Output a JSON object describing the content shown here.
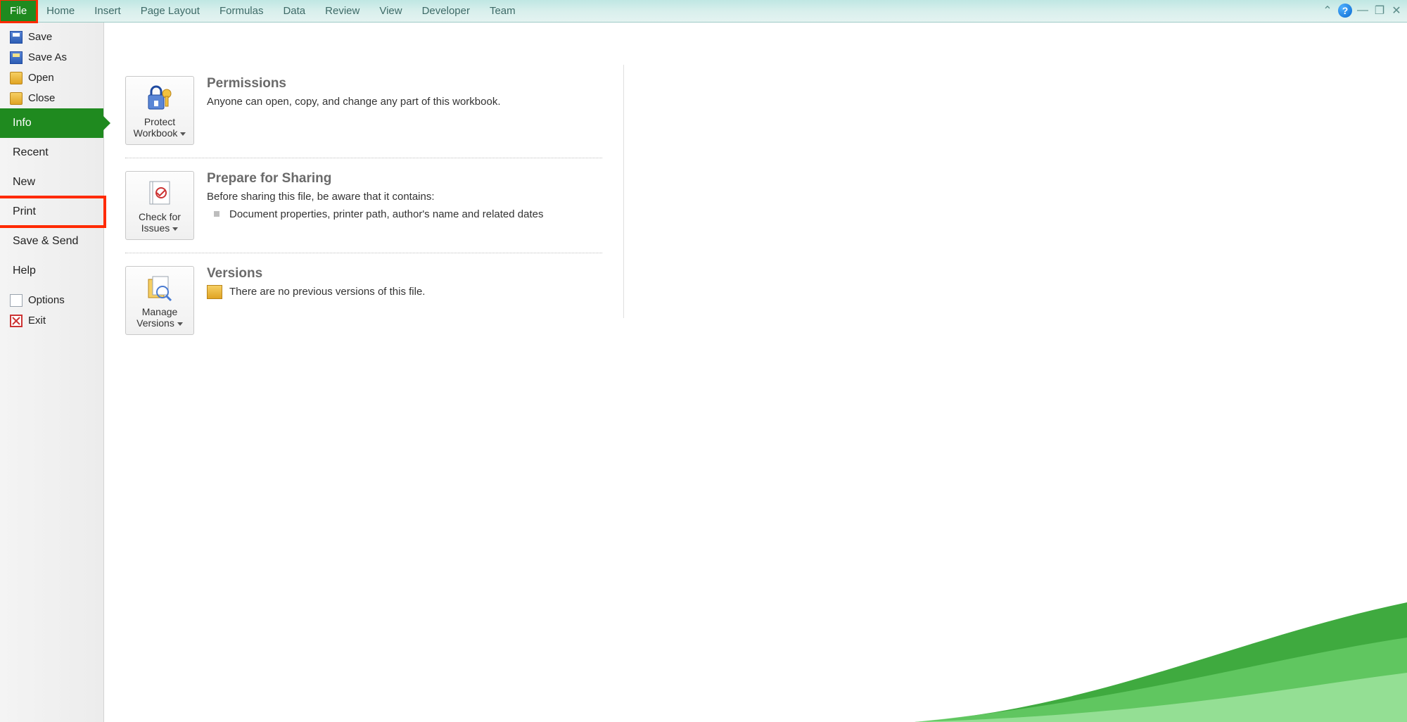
{
  "ribbon": {
    "tabs": [
      "File",
      "Home",
      "Insert",
      "Page Layout",
      "Formulas",
      "Data",
      "Review",
      "View",
      "Developer",
      "Team"
    ],
    "active": "File"
  },
  "sidebar": {
    "top": [
      {
        "label": "Save",
        "icon": "save"
      },
      {
        "label": "Save As",
        "icon": "saveas"
      },
      {
        "label": "Open",
        "icon": "folder"
      },
      {
        "label": "Close",
        "icon": "folder"
      }
    ],
    "major": [
      {
        "label": "Info",
        "selected": true
      },
      {
        "label": "Recent"
      },
      {
        "label": "New"
      },
      {
        "label": "Print",
        "highlight": true
      },
      {
        "label": "Save & Send"
      },
      {
        "label": "Help"
      }
    ],
    "bottom": [
      {
        "label": "Options",
        "icon": "doc"
      },
      {
        "label": "Exit",
        "icon": "close-x"
      }
    ]
  },
  "info": {
    "permissions": {
      "title": "Permissions",
      "text": "Anyone can open, copy, and change any part of this workbook.",
      "button": "Protect Workbook"
    },
    "prepare": {
      "title": "Prepare for Sharing",
      "text": "Before sharing this file, be aware that it contains:",
      "bullet": "Document properties, printer path, author's name and related dates",
      "button": "Check for Issues"
    },
    "versions": {
      "title": "Versions",
      "text": "There are no previous versions of this file.",
      "button": "Manage Versions"
    }
  },
  "titlebar": {
    "help": "?",
    "collapse": "^"
  },
  "colors": {
    "accent": "#1f8a1f",
    "highlight_border": "#ff2a00"
  }
}
